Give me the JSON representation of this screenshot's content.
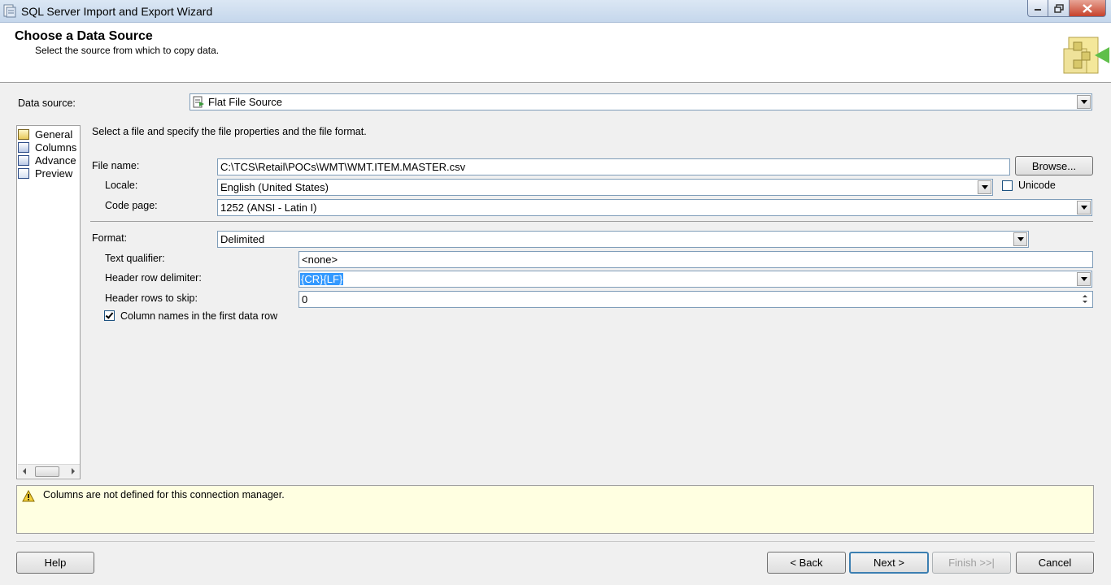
{
  "window": {
    "title": "SQL Server Import and Export Wizard"
  },
  "header": {
    "title": "Choose a Data Source",
    "subtitle": "Select the source from which to copy data."
  },
  "data_source": {
    "label": "Data source:",
    "value": "Flat File Source"
  },
  "nav": {
    "items": [
      {
        "label": "General",
        "icon": "general-page-icon"
      },
      {
        "label": "Columns",
        "icon": "columns-page-icon"
      },
      {
        "label": "Advance",
        "icon": "advanced-page-icon"
      },
      {
        "label": "Preview",
        "icon": "preview-page-icon"
      }
    ]
  },
  "main": {
    "instruction": "Select a file and specify the file properties and the file format.",
    "file_name_label": "File name:",
    "file_name_value": "C:\\TCS\\Retail\\POCs\\WMT\\WMT.ITEM.MASTER.csv",
    "browse_label": "Browse...",
    "locale_label": "Locale:",
    "locale_value": "English (United States)",
    "unicode_label": "Unicode",
    "code_page_label": "Code page:",
    "code_page_value": "1252  (ANSI - Latin I)",
    "format_label": "Format:",
    "format_value": "Delimited",
    "text_qualifier_label": "Text qualifier:",
    "text_qualifier_value": "<none>",
    "header_row_delim_label": "Header row delimiter:",
    "header_row_delim_value": "{CR}{LF}",
    "header_rows_skip_label": "Header rows to skip:",
    "header_rows_skip_value": "0",
    "column_names_label": "Column names in the first data row",
    "column_names_checked": true,
    "unicode_checked": false
  },
  "warning": {
    "message": "Columns are not defined for this connection manager."
  },
  "footer": {
    "help": "Help",
    "back": "< Back",
    "next": "Next >",
    "finish": "Finish >>|",
    "cancel": "Cancel"
  },
  "colors": {
    "selection": "#3399ff",
    "warning_bg": "#ffffe1",
    "default_button_border": "#3c7fb1"
  }
}
